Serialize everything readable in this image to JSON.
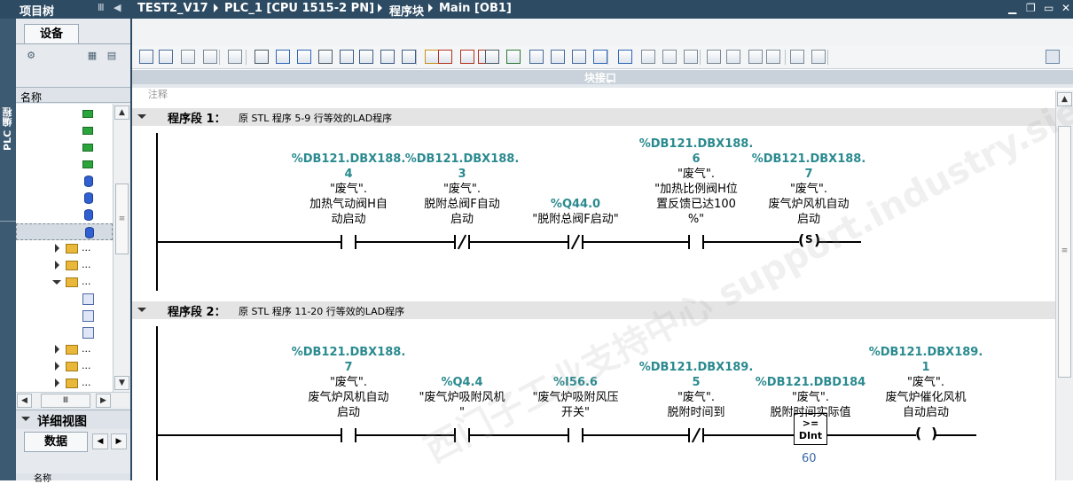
{
  "left_panel": {
    "title": "项目树",
    "vertical_tab": "PLC 编程",
    "device_tab": "设备",
    "column_header": "名称",
    "tree_items": [
      {
        "kind": "green",
        "label": ""
      },
      {
        "kind": "green",
        "label": ""
      },
      {
        "kind": "green",
        "label": ""
      },
      {
        "kind": "green",
        "label": ""
      },
      {
        "kind": "blue",
        "label": ""
      },
      {
        "kind": "blue",
        "label": ""
      },
      {
        "kind": "blue",
        "label": ""
      },
      {
        "kind": "blue",
        "label": ""
      },
      {
        "kind": "folder",
        "label": "..."
      },
      {
        "kind": "folder",
        "label": "..."
      },
      {
        "kind": "folder-open",
        "label": "..."
      },
      {
        "kind": "block",
        "label": ""
      },
      {
        "kind": "block",
        "label": ""
      },
      {
        "kind": "block",
        "label": ""
      },
      {
        "kind": "folder",
        "label": "..."
      },
      {
        "kind": "folder",
        "label": "..."
      },
      {
        "kind": "folder",
        "label": "..."
      }
    ],
    "detail_view": "详细视图",
    "data_tab": "数据",
    "bottom_header": "名称"
  },
  "editor": {
    "breadcrumb": [
      "TEST2_V17",
      "PLC_1 [CPU 1515-2 PN]",
      "程序块",
      "Main [OB1]"
    ],
    "interface_label": "块接口",
    "comment_stub": "注释",
    "watermark": "西门子工业支持中心 support.industry.siemens.com",
    "networks": [
      {
        "title": "程序段 1：",
        "comment": "原 STL 程序 5-9 行等效的LAD程序",
        "elements": [
          {
            "type": "NO",
            "addr": "%DB121.DBX188.\n4",
            "sym": "\"废气\".\n加热气动阀H自\n动启动"
          },
          {
            "type": "NC",
            "addr": "%DB121.DBX188.\n3",
            "sym": "\"废气\".\n脱附总阀F自动\n启动"
          },
          {
            "type": "NC",
            "addr": "%Q44.0",
            "sym": "\"脱附总阀F启动\""
          },
          {
            "type": "NO",
            "addr": "%DB121.DBX188.\n6",
            "sym": "\"废气\".\n\"加热比例阀H位\n置反馈已达100\n%\""
          },
          {
            "type": "S",
            "addr": "%DB121.DBX188.\n7",
            "sym": "\"废气\".\n废气炉风机自动\n启动",
            "coil_text": "S"
          }
        ]
      },
      {
        "title": "程序段 2：",
        "comment": "原 STL 程序 11-20 行等效的LAD程序",
        "elements": [
          {
            "type": "NO",
            "addr": "%DB121.DBX188.\n7",
            "sym": "\"废气\".\n废气炉风机自动\n启动"
          },
          {
            "type": "NO",
            "addr": "%Q4.4",
            "sym": "\"废气炉吸附风机\n\""
          },
          {
            "type": "NO",
            "addr": "%I56.6",
            "sym": "\"废气炉吸附风压\n开关\""
          },
          {
            "type": "NC",
            "addr": "%DB121.DBX189.\n5",
            "sym": "\"废气\".\n脱附时间到"
          },
          {
            "type": "CMP",
            "addr": "%DB121.DBD184",
            "sym": "\"废气\".\n脱附时间实际值",
            "op": ">=",
            "dtype": "DInt",
            "operand2": "60"
          },
          {
            "type": "COIL",
            "addr": "%DB121.DBX189.\n1",
            "sym": "\"废气\".\n废气炉催化风机\n自动启动"
          }
        ]
      }
    ]
  }
}
